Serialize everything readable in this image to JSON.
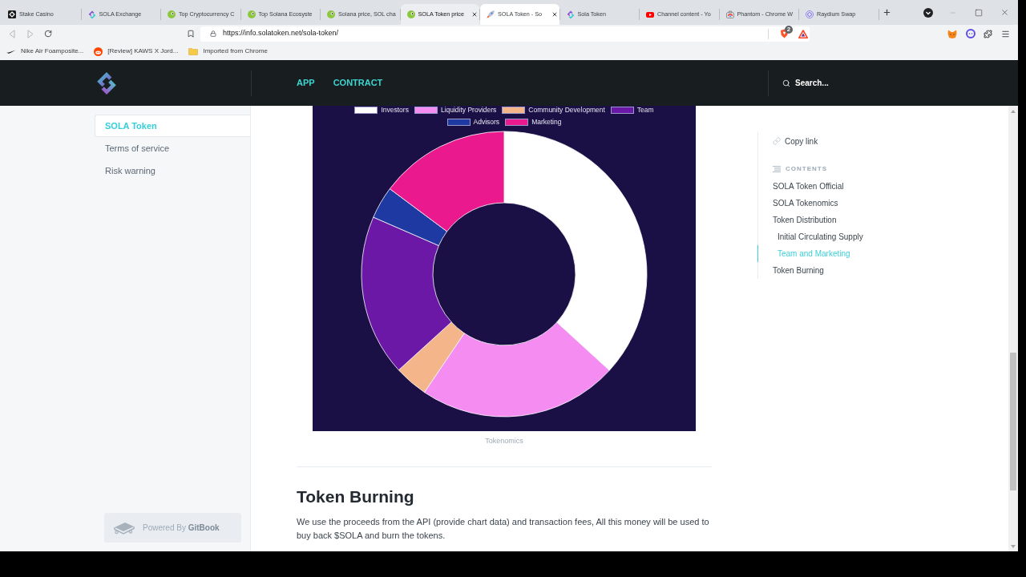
{
  "browser": {
    "tabs": [
      {
        "title": "Stake Casino",
        "selected": false,
        "hovered": false
      },
      {
        "title": "SOLA Exchange",
        "selected": false,
        "hovered": false
      },
      {
        "title": "Top Cryptocurrency C",
        "selected": false,
        "hovered": false
      },
      {
        "title": "Top Solana Ecosyste",
        "selected": false,
        "hovered": false
      },
      {
        "title": "Solana price, SOL cha",
        "selected": false,
        "hovered": false
      },
      {
        "title": "SOLA Token price",
        "selected": false,
        "hovered": true
      },
      {
        "title": "SOLA Token - So",
        "selected": true,
        "hovered": false
      },
      {
        "title": "Sola Token",
        "selected": false,
        "hovered": false
      },
      {
        "title": "Channel content - Yo",
        "selected": false,
        "hovered": false
      },
      {
        "title": "Phantom - Chrome W",
        "selected": false,
        "hovered": false
      },
      {
        "title": "Raydium Swap",
        "selected": false,
        "hovered": false
      }
    ],
    "address_bar": {
      "url": "https://info.solatoken.net/sola-token/",
      "shield_badge": "2"
    },
    "bookmarks": [
      {
        "label": "Nike Air Foamposite..."
      },
      {
        "label": "[Review] KAWS X Jord..."
      },
      {
        "label": "Imported from Chrome"
      }
    ]
  },
  "header": {
    "nav": [
      {
        "label": "APP"
      },
      {
        "label": "CONTRACT"
      }
    ],
    "search": {
      "placeholder": "Search..."
    }
  },
  "sidebar": {
    "items": [
      {
        "label": "SOLA Token",
        "selected": true
      },
      {
        "label": "Terms of service",
        "selected": false
      },
      {
        "label": "Risk warning",
        "selected": false
      }
    ],
    "footer": "Powered By **GitBook**"
  },
  "chart": {
    "legend": [
      {
        "label": "Investors",
        "color": "#ffffff"
      },
      {
        "label": "Liquidity Providers",
        "color": "#f48cf2"
      },
      {
        "label": "Community Development",
        "color": "#f5b58a"
      },
      {
        "label": "Team",
        "color": "#6b18a6"
      },
      {
        "label": "Advisors",
        "color": "#1e3aa2"
      },
      {
        "label": "Marketing",
        "color": "#ea1a8e"
      }
    ],
    "caption": "Tokenomics"
  },
  "section": {
    "heading": "Token Burning",
    "paragraph": "We use the proceeds from the API (provide chart data) and transaction fees, All this money will be used to buy back $SOLA and burn the tokens."
  },
  "toc": {
    "copy_link": "Copy link",
    "heading": "CONTENTS",
    "items": [
      {
        "label": "SOLA Token Official",
        "selected": false
      },
      {
        "label": "SOLA Tokenomics",
        "selected": false
      },
      {
        "label": "Token Distribution",
        "selected": false,
        "children": [
          {
            "label": "Initial Circulating Supply",
            "selected": false
          },
          {
            "label": "Team and Marketing",
            "selected": true
          }
        ]
      },
      {
        "label": "Token Burning",
        "selected": false
      }
    ]
  }
}
